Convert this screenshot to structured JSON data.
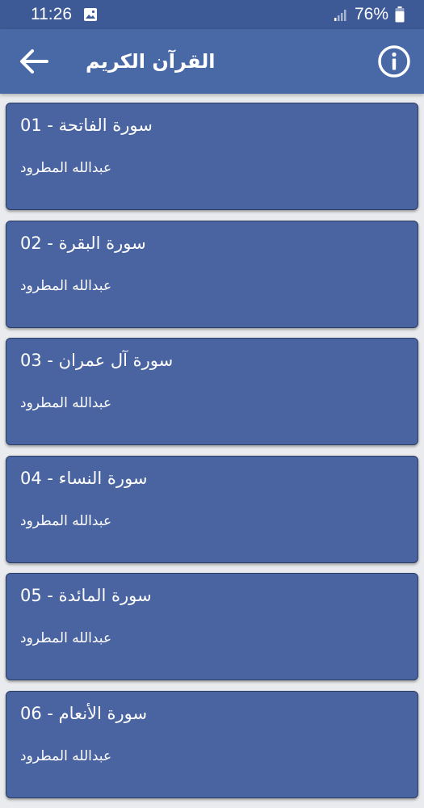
{
  "status_bar": {
    "time": "11:26",
    "battery": "76%"
  },
  "app_bar": {
    "title": "القرآن الكريم",
    "back_icon": "arrow-back-icon",
    "info_icon": "info-icon"
  },
  "surahs": [
    {
      "number": "01",
      "name": "سورة الفاتحة",
      "reciter": "عبدالله المطرود"
    },
    {
      "number": "02",
      "name": "سورة البقرة",
      "reciter": "عبدالله المطرود"
    },
    {
      "number": "03",
      "name": "سورة آل عمران",
      "reciter": "عبدالله المطرود"
    },
    {
      "number": "04",
      "name": "سورة النساء",
      "reciter": "عبدالله المطرود"
    },
    {
      "number": "05",
      "name": "سورة المائدة",
      "reciter": "عبدالله المطرود"
    },
    {
      "number": "06",
      "name": "سورة الأنعام",
      "reciter": "عبدالله المطرود"
    }
  ],
  "colors": {
    "status_bar": "#3d5a96",
    "app_bar": "#4968a6",
    "card": "#4a64a1",
    "card_border": "#2b3d63",
    "background": "#e9ebee"
  }
}
